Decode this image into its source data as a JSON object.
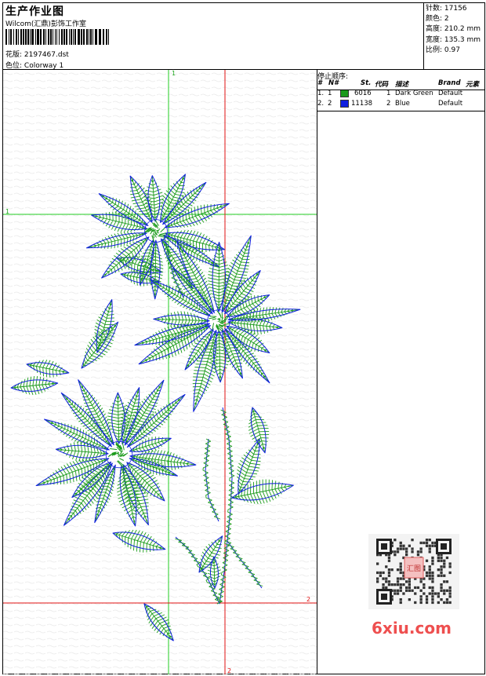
{
  "header": {
    "title": "生产作业图",
    "studio": "Wilcom(汇鼎)彭饰工作室",
    "design_label": "花版:",
    "design_value": "2197467.dst",
    "colorway_label": "色位:",
    "colorway_value": "Colorway 1"
  },
  "stats": {
    "stitches": "针数: 17156",
    "colors": "颜色: 2",
    "height": "高度: 210.2 mm",
    "width": "宽度: 135.3 mm",
    "scale": "比例: 0.97"
  },
  "stop_sequence": {
    "title": "停止顺序:",
    "headers": [
      "#",
      "N#",
      "St.",
      "代码",
      "描述",
      "Brand",
      "元素"
    ],
    "rows": [
      {
        "index": "1.",
        "n": "1",
        "stitches": "6016",
        "code": "1",
        "desc": "Dark Green",
        "brand": "Default",
        "swatch": "#1a9a1a"
      },
      {
        "index": "2.",
        "n": "2",
        "stitches": "11138",
        "code": "2",
        "desc": "Blue",
        "brand": "Default",
        "swatch": "#1020e0"
      }
    ]
  },
  "guides": {
    "green_top": "1",
    "green_left": "1",
    "red_right": "2",
    "red_bottom": "2"
  },
  "watermark": {
    "text": "6xiu.com",
    "stamp": "汇图"
  },
  "colors": {
    "thread_green": "#1a9a1a",
    "thread_blue": "#1020e0",
    "guide_green": "#22cc22",
    "guide_red": "#e01010",
    "watermark_red": "#ee4f4f"
  }
}
